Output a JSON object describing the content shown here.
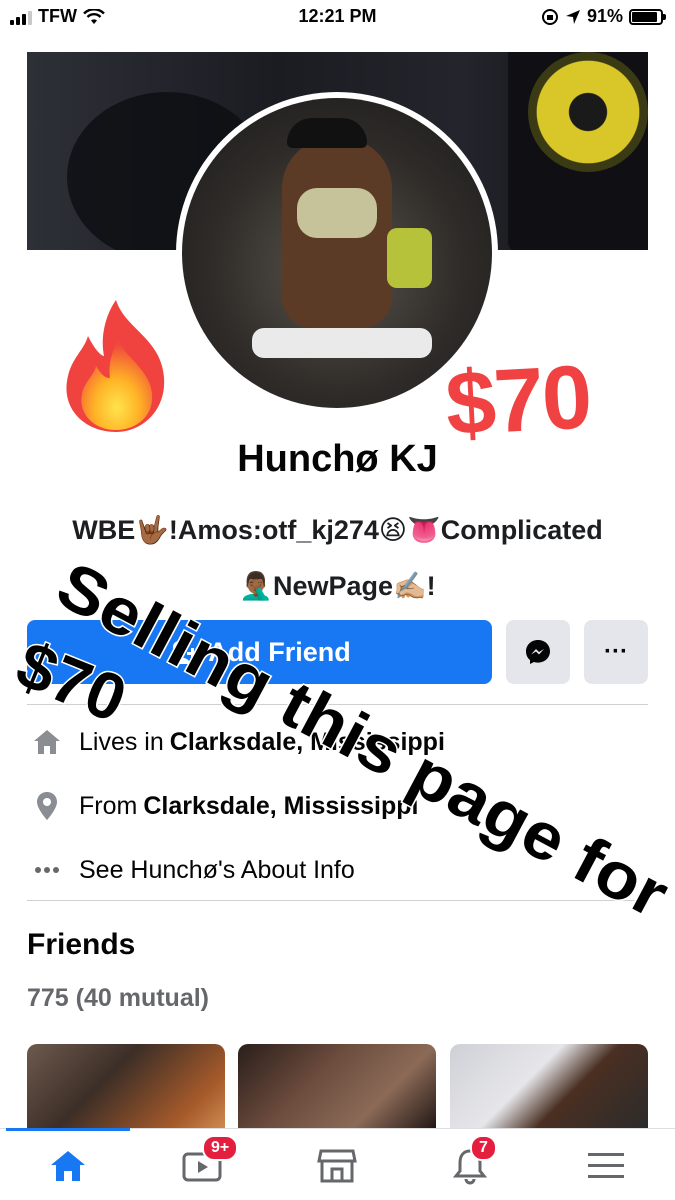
{
  "status_bar": {
    "carrier": "TFW",
    "time": "12:21 PM",
    "battery_percent": "91%"
  },
  "profile": {
    "name": "Hunchø KJ",
    "bio_line1": "WBE🤟🏾!Amos:otf_kj274😫👅Complicated",
    "bio_line2": "🤦🏾‍♂️NewPage✍🏼!"
  },
  "overlays": {
    "price_big": "$70",
    "diagonal_text_line1": "Selling this page for",
    "diagonal_text_line2": "$70"
  },
  "actions": {
    "add_friend_label": "Add Friend",
    "messenger_icon": "messenger-icon",
    "more_label": "···"
  },
  "about": {
    "lives_prefix": "Lives in",
    "lives_place": "Clarksdale, Mississippi",
    "from_prefix": "From",
    "from_place": "Clarksdale, Mississippi",
    "see_about": "See Hunchø's About Info"
  },
  "friends": {
    "title": "Friends",
    "count": "775 (40 mutual)"
  },
  "bottom_nav": {
    "watch_badge": "9+",
    "notifications_badge": "7"
  },
  "colors": {
    "accent": "#1877f2",
    "price": "#f04242",
    "badge": "#e41e3f"
  }
}
